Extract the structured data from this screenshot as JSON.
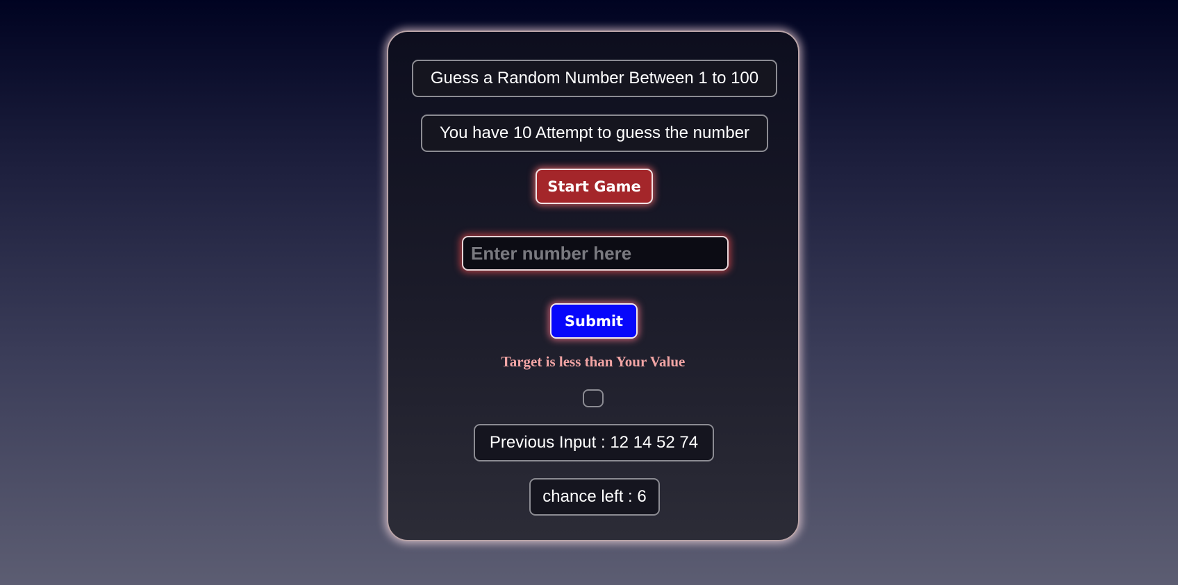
{
  "game": {
    "title": "Guess a Random Number Between 1 to 100",
    "attempts_text": "You have 10 Attempt to guess the number",
    "start_button_label": "Start Game",
    "input_placeholder": "Enter number here",
    "input_value": "",
    "submit_button_label": "Submit",
    "hint_message": "Target is less than Your Value",
    "result_message": "",
    "previous_input_text": "Previous Input : 12 14 52 74",
    "chance_left_text": "chance left : 6"
  },
  "colors": {
    "start_button": "#a4262a",
    "submit_button": "#0707fb",
    "hint_text": "#f2a5a5"
  }
}
